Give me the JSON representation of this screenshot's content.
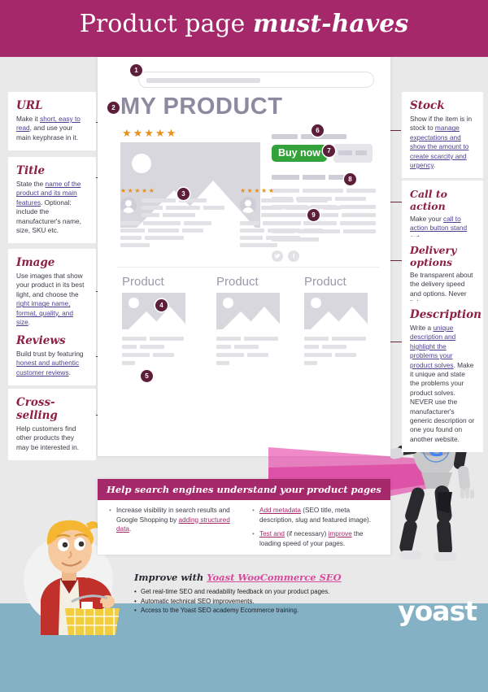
{
  "header": {
    "title_plain": "Product page ",
    "title_em": "must-haves",
    "bg_color": "#a4286a"
  },
  "mockup": {
    "product_title": "MY PRODUCT",
    "stars": "★★★★★",
    "buy_now_label": "Buy now",
    "buy_now_color": "#33a23a",
    "star_color": "#e8901f",
    "product_cards": [
      {
        "label": "Product"
      },
      {
        "label": "Product"
      },
      {
        "label": "Product"
      }
    ],
    "social_icons": [
      {
        "name": "twitter-icon"
      },
      {
        "name": "facebook-icon"
      }
    ]
  },
  "markers": [
    {
      "n": "1"
    },
    {
      "n": "2"
    },
    {
      "n": "3"
    },
    {
      "n": "4"
    },
    {
      "n": "5"
    },
    {
      "n": "6"
    },
    {
      "n": "7"
    },
    {
      "n": "8"
    },
    {
      "n": "9"
    }
  ],
  "left_boxes": [
    {
      "title": "URL",
      "parts": [
        {
          "t": "Make it ",
          "link": false
        },
        {
          "t": "short, easy to read",
          "link": true
        },
        {
          "t": ", and use your main keyphrase in it.",
          "link": false
        }
      ]
    },
    {
      "title": "Title",
      "parts": [
        {
          "t": "State the ",
          "link": false
        },
        {
          "t": "name of the product and its main features",
          "link": true
        },
        {
          "t": ". Optional: include the manufacturer's name, size, SKU etc.",
          "link": false
        }
      ]
    },
    {
      "title": "Image",
      "parts": [
        {
          "t": "Use images that show your product in its best light, and choose the ",
          "link": false
        },
        {
          "t": "right image name, format, quality, and size",
          "link": true
        },
        {
          "t": ".",
          "link": false
        }
      ]
    },
    {
      "title": "Reviews",
      "parts": [
        {
          "t": "Build trust by featuring ",
          "link": false
        },
        {
          "t": "honest and authentic customer reviews",
          "link": true
        },
        {
          "t": ".",
          "link": false
        }
      ]
    },
    {
      "title": "Cross-selling",
      "parts": [
        {
          "t": "Help customers find other products they may be interested in.",
          "link": false
        }
      ]
    }
  ],
  "right_boxes": [
    {
      "title": "Stock",
      "parts": [
        {
          "t": "Show if the item is in stock to ",
          "link": false
        },
        {
          "t": "manage expectations and show the amount to create scarcity and urgency",
          "link": true
        },
        {
          "t": ".",
          "link": false
        }
      ]
    },
    {
      "title": "Call to action",
      "parts": [
        {
          "t": "Make your ",
          "link": false
        },
        {
          "t": "call to action button stand out",
          "link": true
        },
        {
          "t": ".",
          "link": false
        }
      ]
    },
    {
      "title": "Delivery options",
      "parts": [
        {
          "t": "Be transparent about the delivery speed and options. Never lie!",
          "link": false
        }
      ]
    },
    {
      "title": "Description",
      "parts": [
        {
          "t": "Write a ",
          "link": false
        },
        {
          "t": "unique description and highlight the problems your product solves",
          "link": true
        },
        {
          "t": ". Make it unique and state the problems your product solves. NEVER use the manufacturer's generic description or one you found on another website.",
          "link": false
        }
      ]
    }
  ],
  "bottom_panel": {
    "heading": "Help search engines understand your product pages",
    "left_items": [
      [
        {
          "t": "Increase visibility in search results and Google Shopping by ",
          "link": false
        },
        {
          "t": "adding structured data",
          "link": true
        },
        {
          "t": ".",
          "link": false
        }
      ]
    ],
    "right_items": [
      [
        {
          "t": "Add metadata",
          "link": true
        },
        {
          "t": " (SEO title, meta description, slug and featured image).",
          "link": false
        }
      ],
      [
        {
          "t": "Test and",
          "link": true
        },
        {
          "t": " (if necessary) ",
          "link": false
        },
        {
          "t": "improve",
          "link": true
        },
        {
          "t": " the loading speed of your pages.",
          "link": false
        }
      ]
    ]
  },
  "footer": {
    "heading_plain": "Improve with ",
    "heading_link": "Yoast WooCommerce SEO",
    "items": [
      "Get real-time SEO and readability feedback on your product pages.",
      "Automatic technical SEO improvements.",
      "Access to the Yoast SEO academy Ecommerce training."
    ],
    "logo": "yoast",
    "band_color": "#84b1c4"
  }
}
